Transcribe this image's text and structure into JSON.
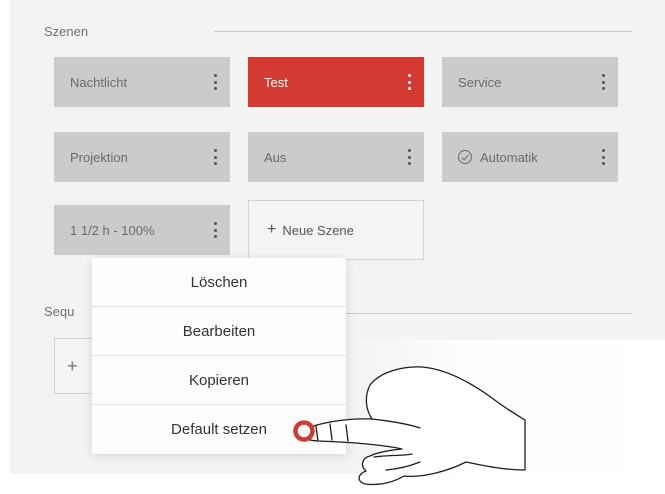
{
  "scenes": {
    "title": "Szenen",
    "tiles": [
      {
        "label": "Nachtlicht",
        "icon": "",
        "state": "normal"
      },
      {
        "label": "Test",
        "icon": "",
        "state": "active"
      },
      {
        "label": "Service",
        "icon": "",
        "state": "normal"
      },
      {
        "label": "Projektion",
        "icon": "",
        "state": "normal"
      },
      {
        "label": "Aus",
        "icon": "",
        "state": "normal"
      },
      {
        "label": "Automatik",
        "icon": "check-circle-icon",
        "state": "normal"
      },
      {
        "label": "1 1/2 h - 100%",
        "icon": "",
        "state": "normal"
      }
    ],
    "new_scene_label": "Neue Szene"
  },
  "sequences": {
    "title": "Sequ",
    "add_symbol": "+"
  },
  "context_menu": {
    "items": [
      "Löschen",
      "Bearbeiten",
      "Kopieren",
      "Default setzen"
    ]
  },
  "colors": {
    "accent": "#d33a31",
    "tile": "#cbcbcb",
    "panel": "#f3f3f3",
    "menu": "#fdfdfd"
  }
}
